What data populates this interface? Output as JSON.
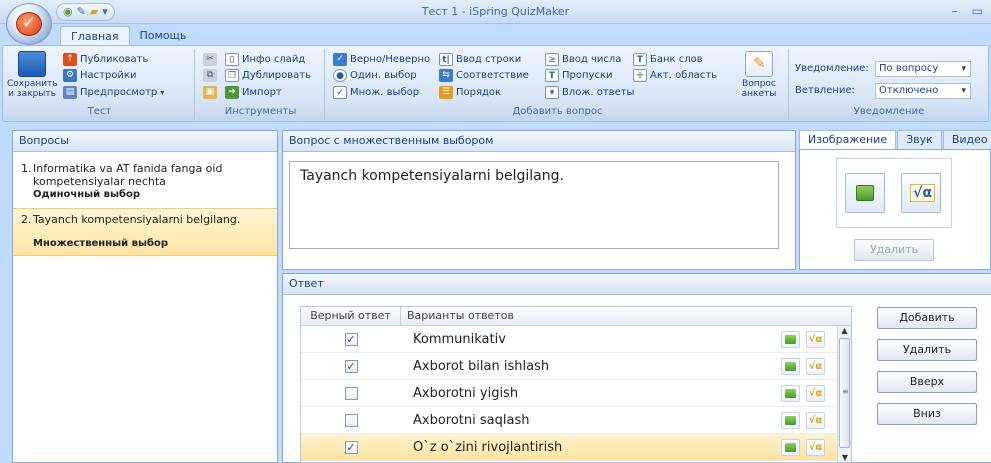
{
  "window": {
    "title": "Тест 1 - iSpring QuizMaker"
  },
  "ribbon": {
    "tabs": [
      "Главная",
      "Помощь"
    ],
    "groups": {
      "test": {
        "label": "Тест",
        "save": "Сохранить и закрыть",
        "publish": "Публиковать",
        "settings": "Настройки",
        "preview": "Предпросмотр"
      },
      "tools": {
        "label": "Инструменты",
        "info_slide": "Инфо слайд",
        "duplicate": "Дублировать",
        "import": "Импорт"
      },
      "add_question": {
        "label": "Добавить вопрос",
        "true_false": "Верно/Неверно",
        "single": "Один. выбор",
        "multiple": "Множ. выбор",
        "type_in": "Ввод строки",
        "matching": "Соответствие",
        "sequence": "Порядок",
        "numeric": "Ввод числа",
        "fill_blanks": "Пропуски",
        "dropdowns": "Влож. ответы",
        "word_bank": "Банк слов",
        "hotspot": "Акт. область",
        "survey": "Вопрос анкеты"
      },
      "notifications": {
        "label": "Уведомление",
        "feedback_label": "Уведомление:",
        "feedback_value": "По вопросу",
        "branching_label": "Ветвление:",
        "branching_value": "Отключено"
      }
    }
  },
  "questions_panel": {
    "title": "Вопросы",
    "items": [
      {
        "num": "1.",
        "text": "Informatika va AT fanida fanga oid kompetensiyalar nechta",
        "type": "Одиночный выбор",
        "selected": false
      },
      {
        "num": "2.",
        "text": "Tayanch kompetensiyalarni belgilang.",
        "type": "Множественный выбор",
        "selected": true
      }
    ]
  },
  "question_editor": {
    "title": "Вопрос с множественным выбором",
    "text": "Tayanch kompetensiyalarni belgilang."
  },
  "media_panel": {
    "tabs": [
      "Изображение",
      "Звук",
      "Видео"
    ],
    "delete_button": "Удалить"
  },
  "answer_panel": {
    "title": "Ответ",
    "columns": [
      "Верный ответ",
      "Варианты ответов"
    ],
    "rows": [
      {
        "correct": true,
        "text": "Kommunikativ",
        "selected": false
      },
      {
        "correct": true,
        "text": "Axborot bilan ishlash",
        "selected": false
      },
      {
        "correct": false,
        "text": "Axborotni yigish",
        "selected": false
      },
      {
        "correct": false,
        "text": "Axborotni saqlash",
        "selected": false
      },
      {
        "correct": true,
        "text": "O`z o`zini rivojlantirish",
        "selected": true
      }
    ],
    "buttons": {
      "add": "Добавить",
      "delete": "Удалить",
      "up": "Вверх",
      "down": "Вниз"
    }
  }
}
